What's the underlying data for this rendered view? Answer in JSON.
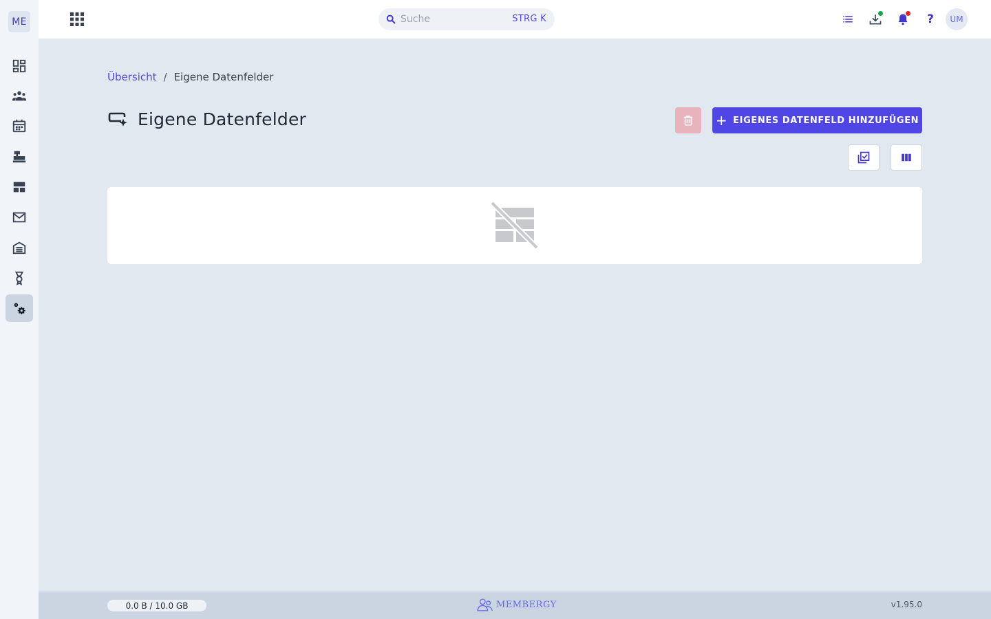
{
  "sidebar": {
    "logo": "ME",
    "items": [
      {
        "name": "dashboard"
      },
      {
        "name": "members"
      },
      {
        "name": "calendar"
      },
      {
        "name": "cash-register"
      },
      {
        "name": "layout"
      },
      {
        "name": "mail"
      },
      {
        "name": "warehouse"
      },
      {
        "name": "award"
      },
      {
        "name": "settings",
        "active": true
      }
    ]
  },
  "topbar": {
    "search": {
      "placeholder": "Suche",
      "shortcut": "STRG K"
    },
    "help": "?",
    "avatar": "UM"
  },
  "breadcrumb": {
    "home": "Übersicht",
    "separator": "/",
    "current": "Eigene Datenfelder"
  },
  "page": {
    "title": "Eigene Datenfelder",
    "add_button": "EIGENES DATENFELD HINZUFÜGEN"
  },
  "footer": {
    "storage": "0.0 B / 10.0 GB",
    "brand": "MEMBERGY",
    "version": "v1.95.0"
  },
  "colors": {
    "accent": "#4f46e5",
    "delete_disabled": "#e8b3bc",
    "page_bg": "#e2e8f0",
    "sidebar_bg": "#f1f5f9",
    "footer_bg": "#cbd5e1"
  }
}
